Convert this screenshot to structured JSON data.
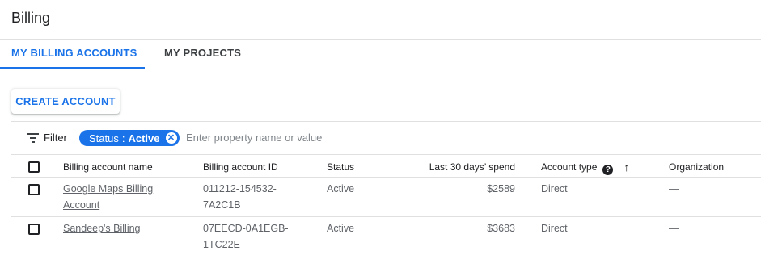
{
  "page": {
    "title": "Billing"
  },
  "tabs": [
    {
      "label": "MY BILLING ACCOUNTS",
      "active": true
    },
    {
      "label": "MY PROJECTS",
      "active": false
    }
  ],
  "toolbar": {
    "create_label": "CREATE ACCOUNT"
  },
  "filter": {
    "label": "Filter",
    "chip": {
      "key": "Status",
      "separator": ":",
      "value": "Active"
    },
    "placeholder": "Enter property name or value"
  },
  "table": {
    "columns": {
      "name": "Billing account name",
      "id": "Billing account ID",
      "status": "Status",
      "spend": "Last 30 days’ spend",
      "type": "Account type",
      "org": "Organization"
    },
    "rows": [
      {
        "name": "Google Maps Billing Account",
        "id": "011212-154532-7A2C1B",
        "status": "Active",
        "spend": "$2589",
        "type": "Direct",
        "org": "—"
      },
      {
        "name": "Sandeep's Billing",
        "id": "07EECD-0A1EGB-1TC22E",
        "status": "Active",
        "spend": "$3683",
        "type": "Direct",
        "org": "—"
      }
    ]
  },
  "colors": {
    "accent": "#1a73e8",
    "text": "#202124",
    "muted": "#5f6368",
    "divider": "#e0e0e0"
  }
}
